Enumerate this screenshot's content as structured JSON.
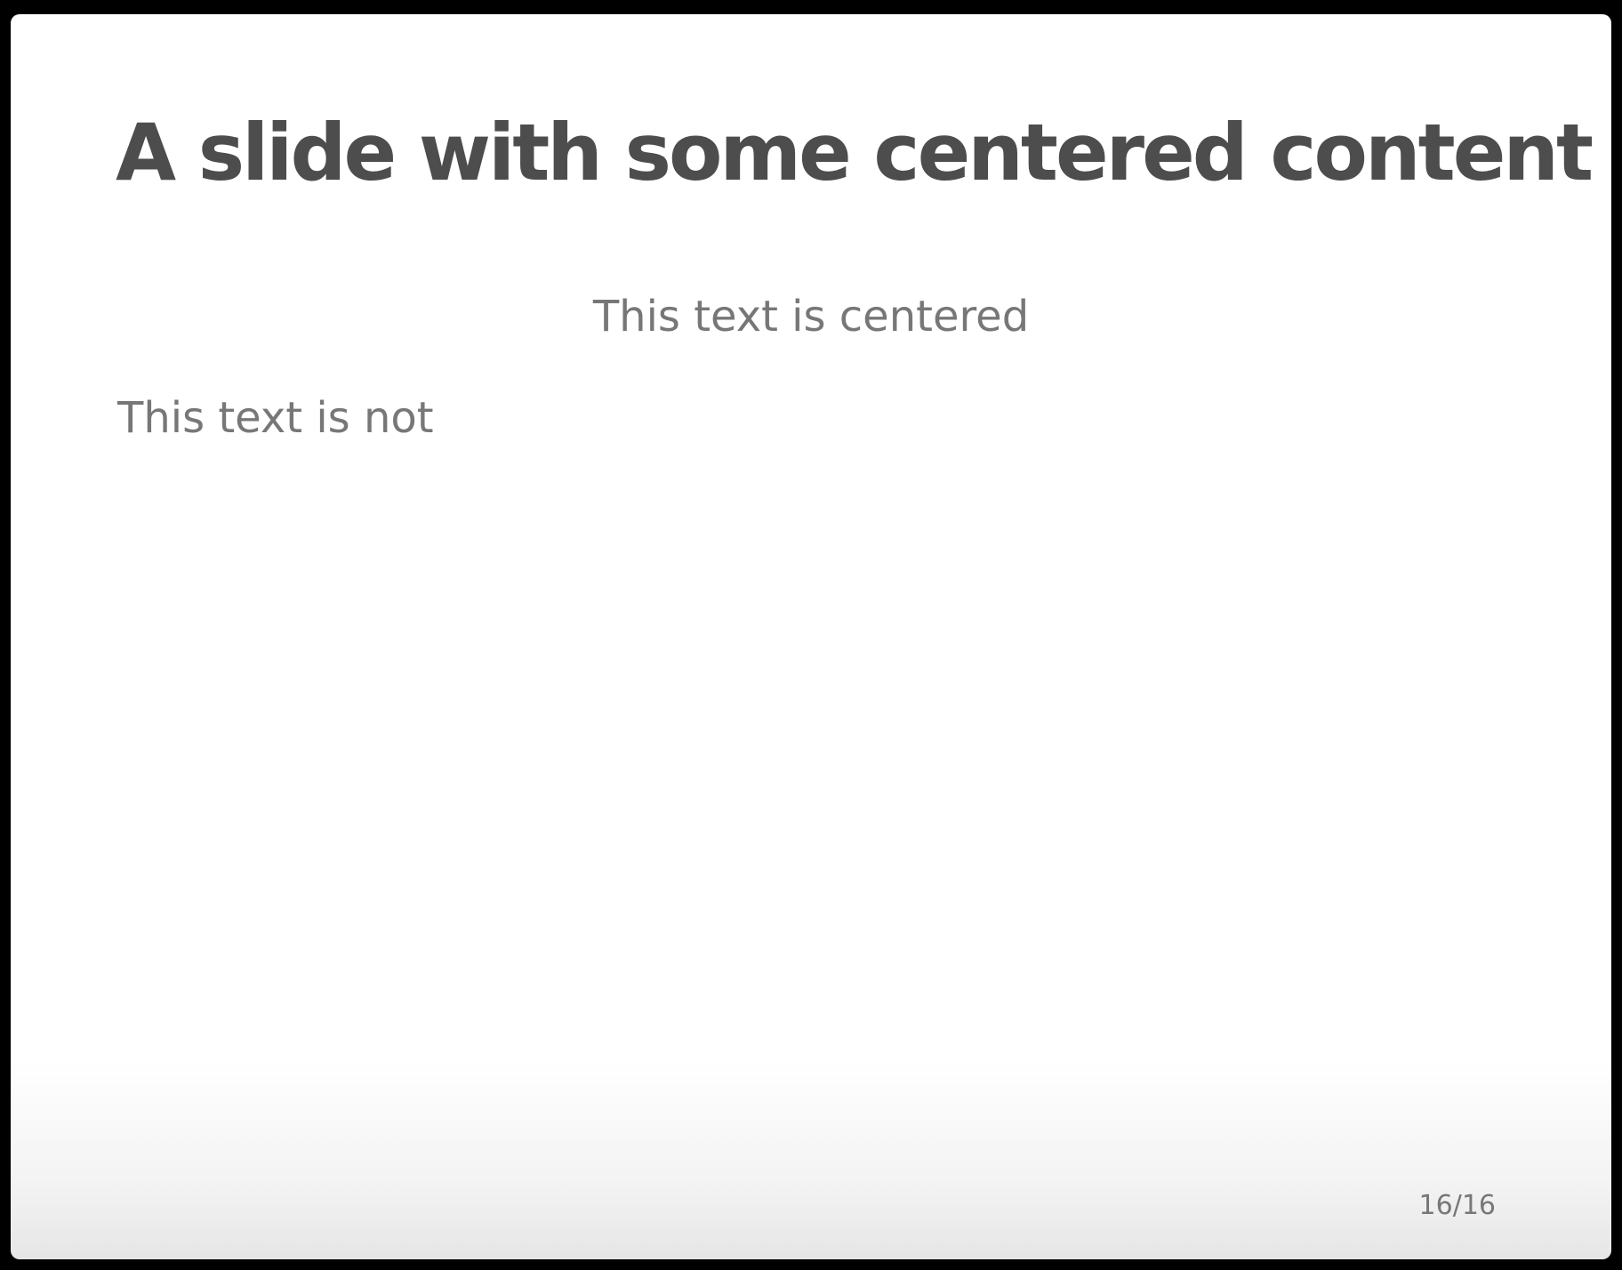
{
  "slide": {
    "title": "A slide with some centered content",
    "centered_text": "This text is centered",
    "left_text": "This text is not",
    "page_number": "16/16"
  },
  "colors": {
    "title": "#4d4d4d",
    "body_text": "#777777",
    "background_outer": "#000000",
    "slide_background": "#ffffff"
  }
}
